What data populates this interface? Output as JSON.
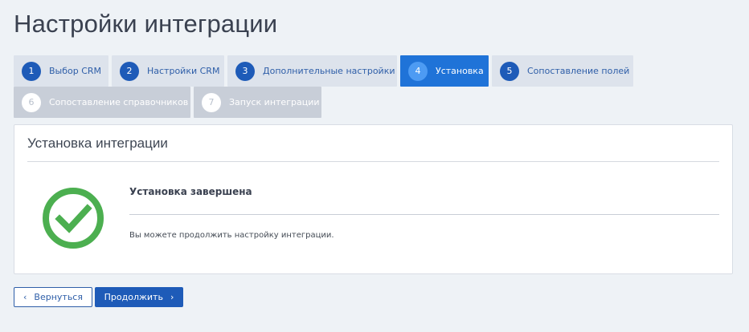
{
  "page": {
    "title": "Настройки интеграции"
  },
  "steps": [
    {
      "num": "1",
      "label": "Выбор CRM",
      "state": "done"
    },
    {
      "num": "2",
      "label": "Настройки CRM",
      "state": "done"
    },
    {
      "num": "3",
      "label": "Дополнительные настройки",
      "state": "done"
    },
    {
      "num": "4",
      "label": "Установка",
      "state": "active"
    },
    {
      "num": "5",
      "label": "Сопоставление полей",
      "state": "done"
    },
    {
      "num": "6",
      "label": "Сопоставление справочников",
      "state": "pending"
    },
    {
      "num": "7",
      "label": "Запуск интеграции",
      "state": "pending"
    }
  ],
  "panel": {
    "title": "Установка интеграции",
    "status_title": "Установка завершена",
    "status_text": "Вы можете продолжить настройку интеграции.",
    "icon": "check-circle-icon",
    "icon_color": "#4caf50"
  },
  "actions": {
    "back_label": "Вернуться",
    "next_label": "Продолжить"
  },
  "colors": {
    "primary": "#1e5bb8",
    "active_step": "#1f73d8",
    "done_step_bg": "#dde3ec",
    "pending_step_bg": "#c8ced8",
    "page_bg": "#eef2f6"
  }
}
